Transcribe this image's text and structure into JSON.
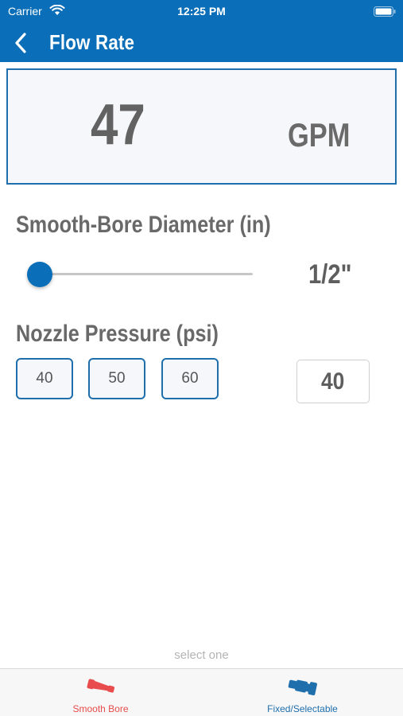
{
  "status_bar": {
    "carrier": "Carrier",
    "time": "12:25 PM"
  },
  "nav": {
    "title": "Flow Rate",
    "back_icon": "chevron-left-icon"
  },
  "result": {
    "value": "47",
    "unit": "GPM"
  },
  "diameter": {
    "label": "Smooth-Bore Diameter (in)",
    "value": "1/2\"",
    "slider_fraction": 0.0
  },
  "pressure": {
    "label": "Nozzle Pressure (psi)",
    "options": [
      "40",
      "50",
      "60"
    ],
    "value": "40"
  },
  "hint": "select one",
  "tabs": [
    {
      "label": "Smooth Bore",
      "icon": "smooth-bore-nozzle-icon",
      "color": "#e84c4c"
    },
    {
      "label": "Fixed/Selectable",
      "icon": "fixed-nozzle-icon",
      "color": "#1f6fad"
    }
  ],
  "colors": {
    "accent": "#0a6fb8",
    "border": "#1f6fad"
  }
}
